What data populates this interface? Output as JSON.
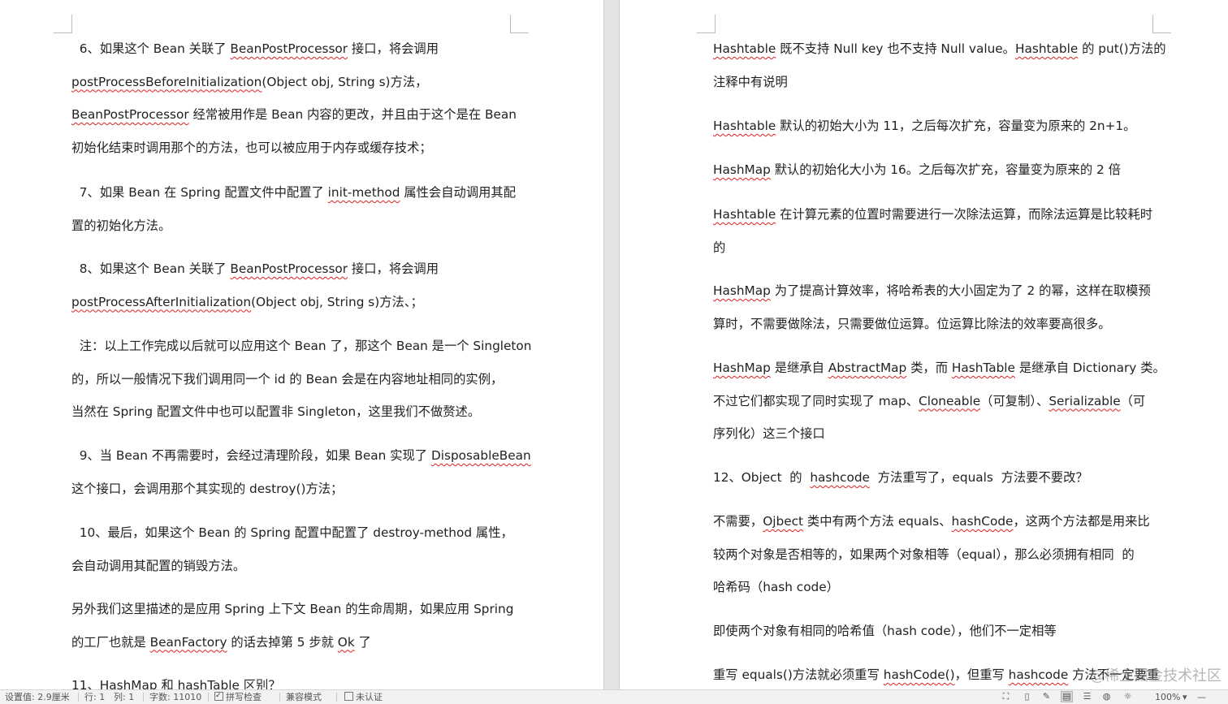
{
  "left_page": {
    "paragraphs": [
      {
        "lines": [
          [
            {
              "t": "  6、如果这个 Bean 关联了 "
            },
            {
              "t": "BeanPostProcessor",
              "sq": true
            },
            {
              "t": " 接口，将会调用"
            }
          ],
          [
            {
              "t": "postProcessBeforeInitialization",
              "sq": true
            },
            {
              "t": "(Object obj, String s)方法，"
            }
          ],
          [
            {
              "t": "BeanPostProcessor",
              "sq": true
            },
            {
              "t": " 经常被用作是 Bean 内容的更改，并且由于这个是在 Bean"
            }
          ],
          [
            {
              "t": "初始化结束时调用那个的方法，也可以被应用于内存或缓存技术；"
            }
          ]
        ]
      },
      {
        "lines": [
          [
            {
              "t": "  7、如果 Bean 在 Spring 配置文件中配置了 "
            },
            {
              "t": "init-method",
              "sq": true
            },
            {
              "t": " 属性会自动调用其配"
            }
          ],
          [
            {
              "t": "置的初始化方法。"
            }
          ]
        ]
      },
      {
        "lines": [
          [
            {
              "t": "  8、如果这个 Bean 关联了 "
            },
            {
              "t": "BeanPostProcessor",
              "sq": true
            },
            {
              "t": " 接口，将会调用"
            }
          ],
          [
            {
              "t": "postProcessAfterInitialization",
              "sq": true
            },
            {
              "t": "(Object obj, String s)方法、；"
            }
          ]
        ]
      },
      {
        "lines": [
          [
            {
              "t": "  注：以上工作完成以后就可以应用这个 Bean 了，那这个 Bean 是一个 Singleton"
            }
          ],
          [
            {
              "t": "的，所以一般情况下我们调用同一个 id 的 Bean 会是在内容地址相同的实例，"
            }
          ],
          [
            {
              "t": "当然在 Spring 配置文件中也可以配置非 Singleton，这里我们不做赘述。"
            }
          ]
        ]
      },
      {
        "lines": [
          [
            {
              "t": "  9、当 Bean 不再需要时，会经过清理阶段，如果 Bean 实现了 "
            },
            {
              "t": "DisposableBean",
              "sq": true
            }
          ],
          [
            {
              "t": "这个接口，会调用那个其实现的 destroy()方法；"
            }
          ]
        ]
      },
      {
        "lines": [
          [
            {
              "t": "  10、最后，如果这个 Bean 的 Spring 配置中配置了 destroy-method 属性，"
            }
          ],
          [
            {
              "t": "会自动调用其配置的销毁方法。"
            }
          ]
        ]
      },
      {
        "lines": [
          [
            {
              "t": "另外我们这里描述的是应用 Spring 上下文 Bean 的生命周期，如果应用 Spring"
            }
          ],
          [
            {
              "t": "的工厂也就是 "
            },
            {
              "t": "BeanFactory",
              "sq": true
            },
            {
              "t": " 的话去掉第 5 步就 "
            },
            {
              "t": "Ok",
              "sq": true
            },
            {
              "t": " 了"
            }
          ]
        ]
      },
      {
        "lines": [
          [
            {
              "t": "11、HashMap 和 hashTable 区别？"
            }
          ]
        ]
      }
    ]
  },
  "right_page": {
    "paragraphs": [
      {
        "lines": [
          [
            {
              "t": "Hashtable",
              "sq": true
            },
            {
              "t": " 既不支持 Null key 也不支持 Null value。"
            },
            {
              "t": "Hashtable",
              "sq": true
            },
            {
              "t": " 的 put()方法的"
            }
          ],
          [
            {
              "t": "注释中有说明"
            }
          ]
        ]
      },
      {
        "lines": [
          [
            {
              "t": "Hashtable",
              "sq": true
            },
            {
              "t": " 默认的初始大小为 11，之后每次扩充，容量变为原来的 2n+1。"
            }
          ]
        ]
      },
      {
        "lines": [
          [
            {
              "t": "HashMap",
              "sq": true
            },
            {
              "t": " 默认的初始化大小为 16。之后每次扩充，容量变为原来的 2 倍"
            }
          ]
        ]
      },
      {
        "lines": [
          [
            {
              "t": "Hashtable",
              "sq": true
            },
            {
              "t": " 在计算元素的位置时需要进行一次除法运算，而除法运算是比较耗时"
            }
          ],
          [
            {
              "t": "的"
            }
          ]
        ]
      },
      {
        "lines": [
          [
            {
              "t": "HashMap",
              "sq": true
            },
            {
              "t": " 为了提高计算效率，将哈希表的大小固定为了 2 的幂，这样在取模预"
            }
          ],
          [
            {
              "t": "算时，不需要做除法，只需要做位运算。位运算比除法的效率要高很多。"
            }
          ]
        ]
      },
      {
        "lines": [
          [
            {
              "t": "HashMap",
              "sq": true
            },
            {
              "t": " 是继承自 "
            },
            {
              "t": "AbstractMap",
              "sq": true
            },
            {
              "t": " 类，而 "
            },
            {
              "t": "HashTable",
              "sq": true
            },
            {
              "t": " 是继承自 Dictionary 类。"
            }
          ],
          [
            {
              "t": "不过它们都实现了同时实现了 map、"
            },
            {
              "t": "Cloneable",
              "sq": true
            },
            {
              "t": "（可复制）、"
            },
            {
              "t": "Serializable",
              "sq": true
            },
            {
              "t": "（可"
            }
          ],
          [
            {
              "t": "序列化）这三个接口"
            }
          ]
        ]
      },
      {
        "lines": [
          [
            {
              "t": "12、Object  的  "
            },
            {
              "t": "hashcode",
              "sq": true
            },
            {
              "t": "  方法重写了，equals  方法要不要改？"
            }
          ]
        ]
      },
      {
        "lines": [
          [
            {
              "t": "不需要，"
            },
            {
              "t": "Ojbect",
              "sq": true
            },
            {
              "t": " 类中有两个方法 equals、"
            },
            {
              "t": "hashCode",
              "sq": true
            },
            {
              "t": "，这两个方法都是用来比"
            }
          ],
          [
            {
              "t": "较两个对象是否相等的，如果两个对象相等（equal），那么必须拥有相同  的"
            }
          ],
          [
            {
              "t": "哈希码（hash code）"
            }
          ]
        ]
      },
      {
        "lines": [
          [
            {
              "t": "即使两个对象有相同的哈希值（hash code），他们不一定相等"
            }
          ]
        ]
      },
      {
        "lines": [
          [
            {
              "t": "重写 equals()方法就必须重写 "
            },
            {
              "t": "hashCode()",
              "sq": true
            },
            {
              "t": "，但重写 "
            },
            {
              "t": "hashcode",
              "sq": true
            },
            {
              "t": " 方法不一定要重"
            }
          ]
        ]
      }
    ]
  },
  "status_bar": {
    "position": "设置值: 2.9厘米",
    "row": "行: 1",
    "col": "列: 1",
    "word_count": "字数: 11010",
    "spell_check": "拼写检查",
    "compat_mode": "兼容模式",
    "certification": "未认证",
    "zoom": "100%",
    "zoom_arrow": "▾",
    "zoom_minus": "—"
  },
  "watermark": "@稀土掘金技术社区"
}
